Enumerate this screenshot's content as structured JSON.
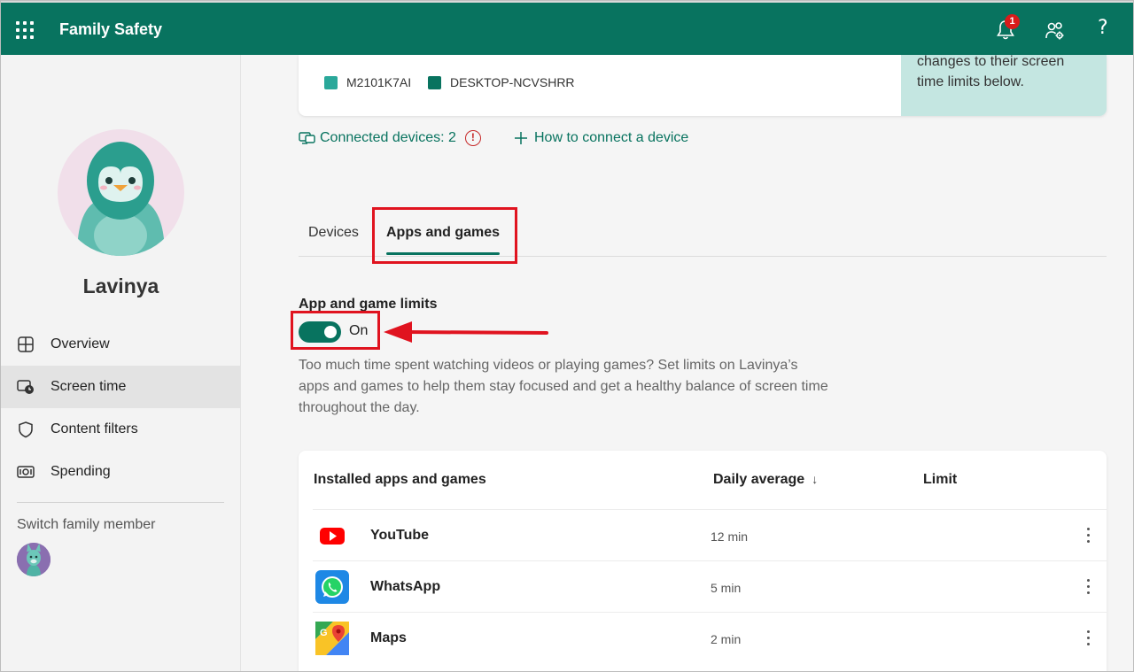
{
  "header": {
    "title": "Family Safety",
    "notification_count": "1",
    "help_label": "?"
  },
  "sidebar": {
    "member_name": "Lavinya",
    "nav": [
      {
        "label": "Overview",
        "icon": "overview-grid-icon"
      },
      {
        "label": "Screen time",
        "icon": "screen-time-icon"
      },
      {
        "label": "Content filters",
        "icon": "shield-icon"
      },
      {
        "label": "Spending",
        "icon": "money-icon"
      }
    ],
    "switch_label": "Switch family member"
  },
  "devices_card": {
    "legend": [
      {
        "label": "M2101K7AI",
        "color": "#2aa89a"
      },
      {
        "label": "DESKTOP-NCVSHRR",
        "color": "#08735f"
      }
    ],
    "info_text": "changes to their screen time limits below."
  },
  "links": {
    "connected_devices": "Connected devices: 2",
    "alert_symbol": "!",
    "how_to_connect": "How to connect a device"
  },
  "tabs": [
    {
      "label": "Devices"
    },
    {
      "label": "Apps and games"
    }
  ],
  "limits": {
    "title": "App and game limits",
    "toggle_state": "On",
    "description": "Too much time spent watching videos or playing games? Set limits on Lavinya’s apps and games to help them stay focused and get a healthy balance of screen time throughout the day."
  },
  "table": {
    "headers": {
      "app": "Installed apps and games",
      "average": "Daily average",
      "sort": "↓",
      "limit": "Limit"
    },
    "rows": [
      {
        "name": "YouTube",
        "time": "12 min",
        "icon": "youtube-icon"
      },
      {
        "name": "WhatsApp",
        "time": "5 min",
        "icon": "whatsapp-icon"
      },
      {
        "name": "Maps",
        "time": "2 min",
        "icon": "maps-icon"
      }
    ]
  },
  "colors": {
    "brand": "#08735f",
    "highlight": "#e0131f",
    "info_panel": "#c4e6e1"
  }
}
